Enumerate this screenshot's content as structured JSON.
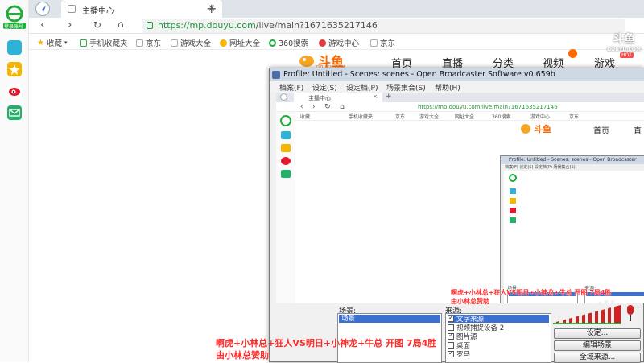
{
  "rail": {
    "login_label": "登录账号",
    "items": [
      "apps-icon",
      "favorites-star-icon",
      "weibo-icon",
      "mail-icon"
    ]
  },
  "tab": {
    "title": "主播中心"
  },
  "address": {
    "scheme": "https://",
    "host": "mp.douyu.com",
    "path": "/live/main?1671635217146"
  },
  "bookmarks": {
    "items": [
      "收藏",
      "手机收藏夹",
      "京东",
      "游戏大全",
      "网址大全",
      "360搜索",
      "游戏中心",
      "京东"
    ]
  },
  "site": {
    "logo": "斗鱼",
    "logo_sub": "DOUYU.COM",
    "nav": [
      "首页",
      "直播",
      "分类",
      "视频",
      "游戏"
    ],
    "hot_badge": "HOT",
    "watermark": "斗鱼",
    "watermark_sub": "DOUYU.COM"
  },
  "obs": {
    "title": "Profile: Untitled - Scenes: scenes - Open Broadcaster Software v0.659b",
    "menu": [
      "档案(F)",
      "设定(S)",
      "设定档(P)",
      "场景集合(S)",
      "帮助(H)"
    ],
    "scenes_label": "场景:",
    "scenes": [
      "场景"
    ],
    "sources_label": "来源:",
    "sources": [
      {
        "label": "文字来源",
        "checked": true,
        "selected": true
      },
      {
        "label": "视频捕捉设备 2",
        "checked": false,
        "selected": false
      },
      {
        "label": "图片源",
        "checked": true,
        "selected": false
      },
      {
        "label": "桌面",
        "checked": false,
        "selected": false
      },
      {
        "label": "罗马",
        "checked": true,
        "selected": false
      }
    ],
    "buttons": {
      "settings": "设定...",
      "edit_scene": "编辑场景",
      "global_sources": "全域来源..."
    }
  },
  "nested": {
    "tab_title": "主播中心",
    "url": "https://mp.douyu.com/live/main?1671635217146",
    "nav": [
      "首页",
      "直"
    ],
    "obs_title": "Profile: Untitled - Scenes: scenes - Open Broadcaster",
    "obs_menu": "档案(F)  设定(S)  设定档(P)  场景集合(S)",
    "scenes_label": "场景:",
    "sources_label": "来源:"
  },
  "overlay": {
    "line1": "啊虎+小林总+狂人VS明日+小神龙+牛总 开图 7局4胜",
    "line2": "由小林总赞助"
  },
  "colors": {
    "accent": "#1a9a39",
    "overlay": "#ff2a2a",
    "selected": "#3b6fd1",
    "meter": "#d42020"
  }
}
